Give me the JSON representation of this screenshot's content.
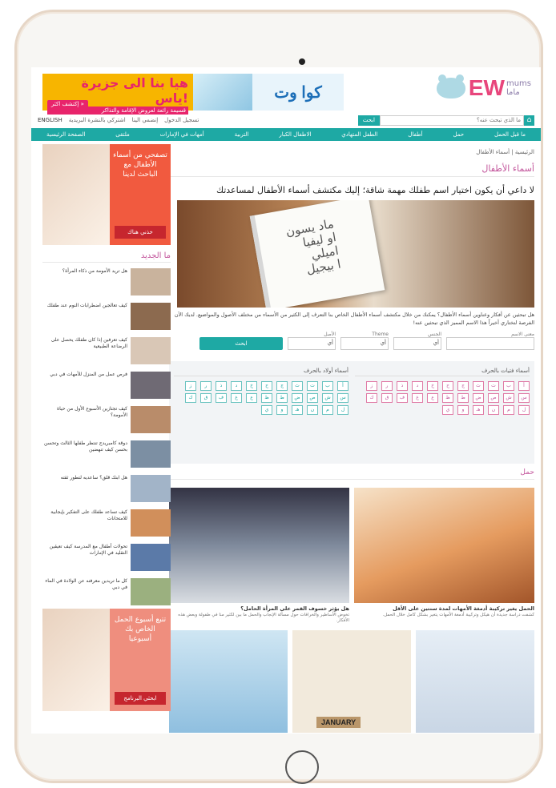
{
  "header": {
    "logo_main": "EW",
    "logo_side_top": "mums",
    "logo_side_bottom": "ماما",
    "banner_title": "هيا بنا الى جزيرة ياس!",
    "banner_sub": "قسيمة رائعة لعروض الإقامة والتذاكر",
    "banner_cta": "إكتشف اكثر »",
    "banner_brand": "كوا وت"
  },
  "search": {
    "placeholder": "ما الذي تبحث عنه؟",
    "button": "ابحث"
  },
  "toplinks": {
    "login": "تسجيل الدخول",
    "signup": "إنضمي الينا",
    "newsletter": "اشتركي بالنشرة البريدية",
    "english": "ENGLISH"
  },
  "nav": {
    "items": [
      "ما قبل الحمل",
      "حمل",
      "أطفال",
      "الطفل المتهادي",
      "الاطفال الكبار",
      "التربية",
      "أمهات في الإمارات",
      "ملتقى",
      "الصفحة الرئيسية"
    ]
  },
  "breadcrumb": {
    "home": "الرئيسية",
    "current": "أسماء الأطفال"
  },
  "page": {
    "title": "أسماء الأطفال",
    "headline": "لا داعي أن يكون اختيار اسم طفلك مهمة شاقة؛ إليك مكتشف أسماء الأطفال لمساعدتك",
    "hero_text": "ماد يسون\nاو ليفيا\nاميلي\nا بيجيل",
    "intro": "هل تبحثين عن أفكار وعناوين أسماء الأطفال؟ يمكنك من خلال مكتشف أسماء الأطفال الخاص بنا التعرف إلى الكثير من الأسماء من مختلف الأصول والمواضيع. لديك الآن الفرصة لتختاري أخيراً هذا الاسم المميز الذي تبحثين عنه!"
  },
  "finder": {
    "meaning_label": "معنى الاسم",
    "gender_label": "الجنس",
    "theme_label": "Theme",
    "origin_label": "الأصل",
    "any": "أي",
    "button": "ابحث"
  },
  "letters": {
    "girls_title": "أسماء فتيات بالحرف",
    "boys_title": "أسماء أولاد بالحرف",
    "girls": [
      "أ",
      "ب",
      "ت",
      "ث",
      "ج",
      "ح",
      "خ",
      "د",
      "ذ",
      "ر",
      "ز",
      "س",
      "ش",
      "ص",
      "ض",
      "ط",
      "ظ",
      "ع",
      "غ",
      "ف",
      "ق",
      "ك",
      "ل",
      "م",
      "ن",
      "هـ",
      "و",
      "ي"
    ],
    "boys": [
      "أ",
      "ب",
      "ت",
      "ث",
      "ج",
      "ح",
      "خ",
      "د",
      "ذ",
      "ر",
      "ز",
      "س",
      "ش",
      "ص",
      "ض",
      "ط",
      "ظ",
      "ع",
      "غ",
      "ف",
      "ق",
      "ك",
      "ل",
      "م",
      "ن",
      "هـ",
      "و",
      "ي"
    ]
  },
  "pregnancy": {
    "section_title": "حمل",
    "articles": [
      {
        "title": "الحمل يغير تركيبة أدمغة الأمهات لمدة سنتين على الأقل",
        "desc": "كشفت دراسة جديدة أن هيكل وتركيبة أدمغة الأمهات يتغير بشكل كامل خلال الحمل."
      },
      {
        "title": "هل يؤثر خسوف القمر على المرأة الحامل؟",
        "desc": "تخوض الأساطير والخرافات حول مسألة الإنجاب والحمل ما بين لكثير منا في طفولة وبعض هذه الأفكار."
      }
    ],
    "calendar": "JANUARY"
  },
  "sidebar": {
    "promo_text": "تصفحي من أسماء الأطفال مع الباحث لدينا",
    "promo_button": "خذني هناك",
    "new_title": "ما الجديد",
    "news": [
      "هل تريد الأمومة من ذكاء المرأة؟",
      "كيف تعالجين اضطرابات النوم عند طفلك",
      "كيف تعرفين إذا كان طفلك يحصل على الرضاعة الطبيعية",
      "فرص عمل من المنزل للأمهات في دبي",
      "كيف تجتازين الأسبوع الأول من حياة الأمومة؟",
      "دوقة كامبريدج تنتظر طفلها الثالث وتحسن بحسن كيف تنهضين",
      "هل ابنك قلق؟ ساعديه لتطور ثقته",
      "كيف تساعد طفلك على التفكير بإيجابية للامتحانات",
      "تحولات أطفال مع المدرسة كيف تعيقين التقليد في الإمارات",
      "كل ما تريدين معرفته عن الولادة في الماء في دبي"
    ],
    "promo2_text": "تتبع أسبوع الحمل الخاص بك أسبوعيا",
    "promo2_button": "ابحثي البرنامج"
  }
}
